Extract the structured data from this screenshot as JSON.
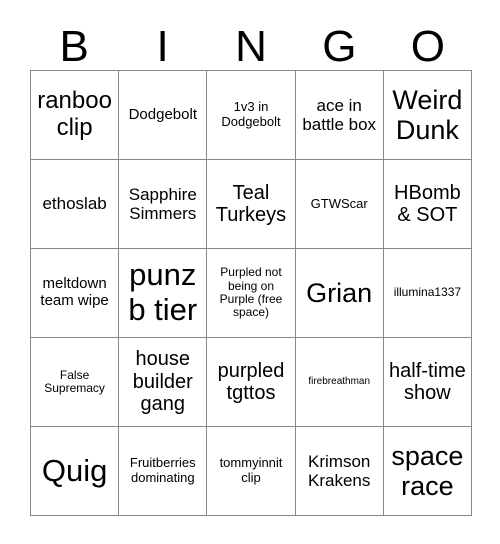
{
  "header": {
    "letters": [
      "B",
      "I",
      "N",
      "G",
      "O"
    ]
  },
  "grid": {
    "rows": 5,
    "columns": 5,
    "free_space_index": 12,
    "border_color": "#888888",
    "background_color": "#ffffff",
    "text_color": "#000000",
    "cells": [
      {
        "text": "ranboo clip",
        "size": "xl"
      },
      {
        "text": "Dodgebolt",
        "size": "m"
      },
      {
        "text": "1v3 in Dodgebolt",
        "size": "sm"
      },
      {
        "text": "ace in battle box",
        "size": "ml"
      },
      {
        "text": "Weird Dunk",
        "size": "xxl"
      },
      {
        "text": "ethoslab",
        "size": "ml"
      },
      {
        "text": "Sapphire Simmers",
        "size": "ml"
      },
      {
        "text": "Teal Turkeys",
        "size": "l"
      },
      {
        "text": "GTWScar",
        "size": "sm"
      },
      {
        "text": "HBomb & SOT",
        "size": "l"
      },
      {
        "text": "meltdown team wipe",
        "size": "m"
      },
      {
        "text": "punz b tier",
        "size": "hg"
      },
      {
        "text": "Purpled not being on Purple (free space)",
        "size": "s"
      },
      {
        "text": "Grian",
        "size": "xxl"
      },
      {
        "text": "illumina1337",
        "size": "s"
      },
      {
        "text": "False Supremacy",
        "size": "s"
      },
      {
        "text": "house builder gang",
        "size": "l"
      },
      {
        "text": "purpled tgttos",
        "size": "l"
      },
      {
        "text": "firebreathman",
        "size": "xs"
      },
      {
        "text": "half-time show",
        "size": "l"
      },
      {
        "text": "Quig",
        "size": "hg"
      },
      {
        "text": "Fruitberries dominating",
        "size": "sm"
      },
      {
        "text": "tommyinnit clip",
        "size": "sm"
      },
      {
        "text": "Krimson Krakens",
        "size": "ml"
      },
      {
        "text": "space race",
        "size": "xxl"
      }
    ]
  }
}
